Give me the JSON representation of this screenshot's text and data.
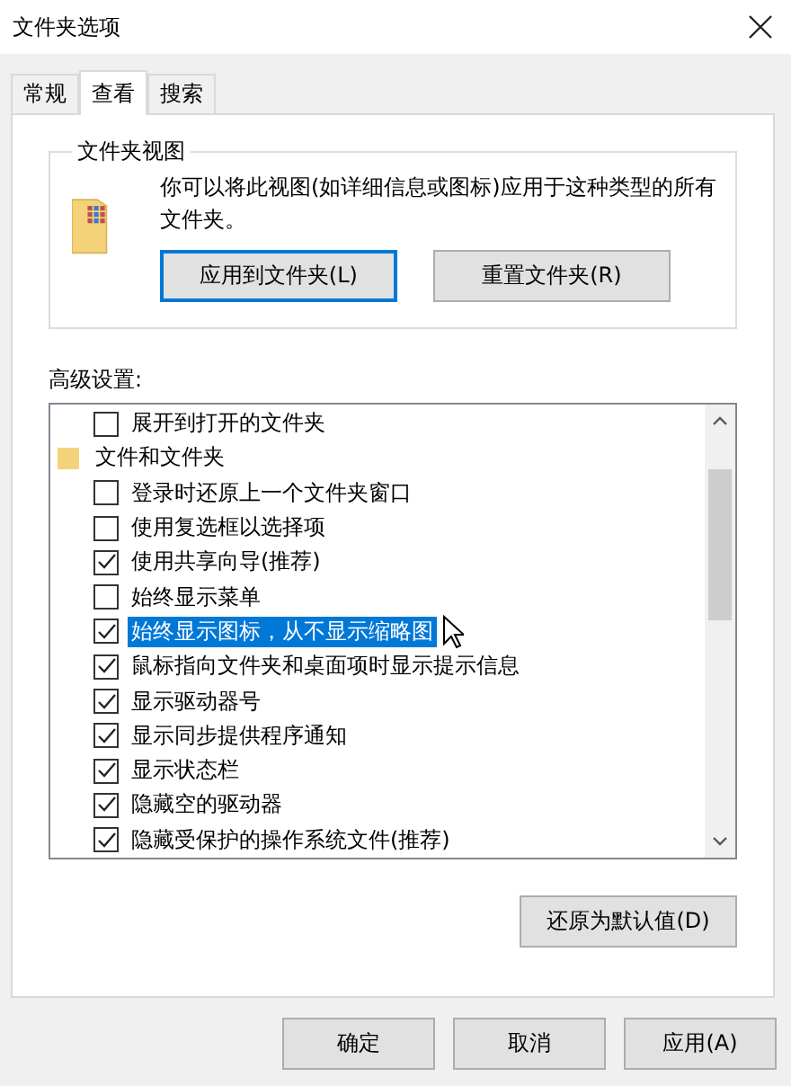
{
  "window": {
    "title": "文件夹选项"
  },
  "tabs": [
    {
      "label": "常规",
      "selected": false
    },
    {
      "label": "查看",
      "selected": true
    },
    {
      "label": "搜索",
      "selected": false
    }
  ],
  "folder_views": {
    "title": "文件夹视图",
    "description": "你可以将此视图(如详细信息或图标)应用于这种类型的所有文件夹。",
    "buttons": [
      {
        "label": "应用到文件夹(L)",
        "selected": true
      },
      {
        "label": "重置文件夹(R)",
        "selected": false
      }
    ]
  },
  "advanced": {
    "label": "高级设置:",
    "items": [
      {
        "kind": "checkbox",
        "label": "展开到打开的文件夹",
        "checked": false,
        "selected": false
      },
      {
        "kind": "folder",
        "label": "文件和文件夹",
        "selected": false
      },
      {
        "kind": "checkbox",
        "label": "登录时还原上一个文件夹窗口",
        "checked": false,
        "selected": false
      },
      {
        "kind": "checkbox",
        "label": "使用复选框以选择项",
        "checked": false,
        "selected": false
      },
      {
        "kind": "checkbox",
        "label": "使用共享向导(推荐)",
        "checked": true,
        "selected": false
      },
      {
        "kind": "checkbox",
        "label": "始终显示菜单",
        "checked": false,
        "selected": false
      },
      {
        "kind": "checkbox",
        "label": "始终显示图标，从不显示缩略图",
        "checked": true,
        "selected": true
      },
      {
        "kind": "checkbox",
        "label": "鼠标指向文件夹和桌面项时显示提示信息",
        "checked": true,
        "selected": false
      },
      {
        "kind": "checkbox",
        "label": "显示驱动器号",
        "checked": true,
        "selected": false
      },
      {
        "kind": "checkbox",
        "label": "显示同步提供程序通知",
        "checked": true,
        "selected": false
      },
      {
        "kind": "checkbox",
        "label": "显示状态栏",
        "checked": true,
        "selected": false
      },
      {
        "kind": "checkbox",
        "label": "隐藏空的驱动器",
        "checked": true,
        "selected": false
      },
      {
        "kind": "checkbox",
        "label": "隐藏受保护的操作系统文件(推荐)",
        "checked": true,
        "selected": false
      }
    ],
    "restore_button": "还原为默认值(D)"
  },
  "buttons": [
    "确定",
    "取消",
    "应用(A)"
  ]
}
